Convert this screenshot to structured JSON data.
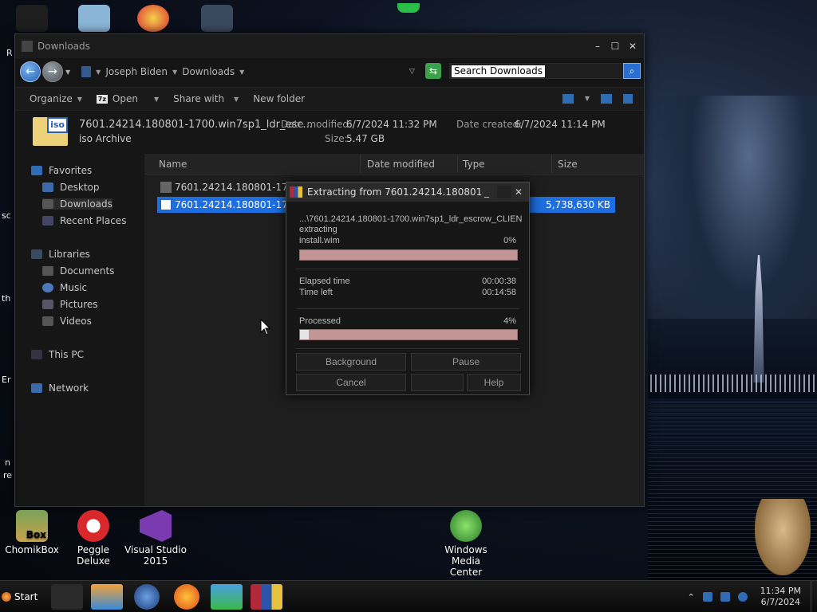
{
  "explorer": {
    "title": "Downloads",
    "breadcrumbs": [
      "Joseph Biden",
      "Downloads"
    ],
    "search_placeholder": "Search Downloads",
    "toolbar": {
      "organize": "Organize",
      "open": "Open",
      "open_icon": "7z",
      "share_with": "Share with",
      "new_folder": "New folder"
    },
    "details": {
      "filename": "7601.24214.180801-1700.win7sp1_ldr_esc...",
      "filetype": "iso Archive",
      "date_modified_label": "Date modified:",
      "date_modified": "6/7/2024 11:32 PM",
      "date_created_label": "Date created:",
      "date_created": "6/7/2024 11:14 PM",
      "size_label": "Size:",
      "size": "5.47 GB",
      "thumb_tag": "iso"
    },
    "nav": {
      "favorites": "Favorites",
      "desktop": "Desktop",
      "downloads": "Downloads",
      "recent_places": "Recent Places",
      "libraries": "Libraries",
      "documents": "Documents",
      "music": "Music",
      "pictures": "Pictures",
      "videos": "Videos",
      "this_pc": "This PC",
      "network": "Network"
    },
    "columns": {
      "name": "Name",
      "date_modified": "Date modified",
      "type": "Type",
      "size": "Size"
    },
    "files": [
      {
        "name": "7601.24214.180801-1700.w",
        "size": ""
      },
      {
        "name": "7601.24214.180801-1700.w",
        "size": "5,738,630 KB"
      }
    ]
  },
  "dialog": {
    "title": "Extracting from 7601.24214.180801-170...",
    "archive_path": "...\\7601.24214.180801-1700.win7sp1_ldr_escrow_CLIEN",
    "status": "extracting",
    "current_file": "install.wim",
    "file_percent_label": "0%",
    "file_progress": 0,
    "elapsed_label": "Elapsed time",
    "elapsed": "00:00:38",
    "time_left_label": "Time left",
    "time_left": "00:14:58",
    "processed_label": "Processed",
    "processed_percent_label": "4%",
    "processed_progress": 4,
    "buttons": {
      "background": "Background",
      "pause": "Pause",
      "cancel": "Cancel",
      "help": "Help"
    }
  },
  "desktop": {
    "icons": [
      {
        "label": "ChomikBox"
      },
      {
        "label": "Peggle Deluxe"
      },
      {
        "label": "Visual Studio 2015"
      },
      {
        "label": "Windows Media Center"
      }
    ],
    "chomik_badge": "Box",
    "edge_texts": [
      "R",
      "sc",
      "th",
      "Er",
      "n",
      "re"
    ]
  },
  "taskbar": {
    "start_label": "Start",
    "time": "11:34 PM",
    "date": "6/7/2024"
  },
  "colors": {
    "selection": "#1d6ee0",
    "progress_track": "#c49595",
    "accent_blue": "#2f6cb3"
  }
}
